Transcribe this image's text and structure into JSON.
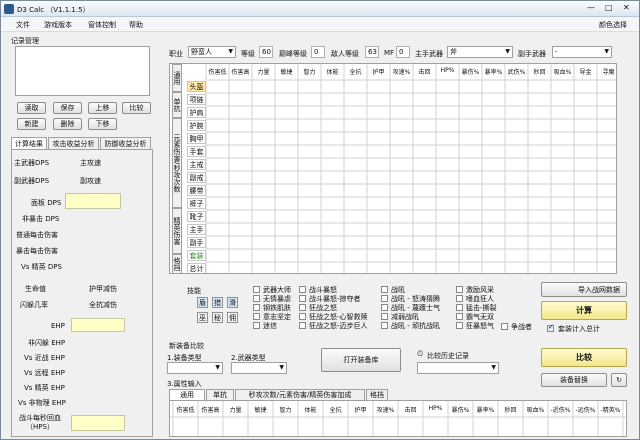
{
  "window": {
    "title": "D3 Calc （V1.1.1.5）",
    "controls": [
      "—",
      "□",
      "✕"
    ]
  },
  "menu": {
    "items": [
      "文件",
      "游戏版本",
      "窗体控制",
      "帮助"
    ],
    "right": "颜色选择"
  },
  "records": {
    "title": "记录管理",
    "buttons": [
      "读取",
      "保存",
      "上移",
      "比较",
      "新建",
      "删除",
      "下移"
    ]
  },
  "left_tabs": [
    "计算结果",
    "攻击收益分析",
    "防御收益分析"
  ],
  "results": {
    "labels1": [
      "主武器DPS",
      "主攻速",
      "副武器DPS",
      "副攻速"
    ],
    "panel_dps": "面板 DPS",
    "labels2": [
      "非暴击 DPS",
      "普通每击伤害",
      "暴击每击伤害",
      "Vs 精英 DPS"
    ],
    "labels3": [
      "生命值",
      "护甲减伤",
      "闪躲几率",
      "全抗减伤"
    ],
    "ehp_labels": [
      "EHP",
      "非闪躲 EHP",
      "Vs 近战 EHP",
      "Vs 远程 EHP",
      "Vs 精英 EHP",
      "Vs 非物理 EHP"
    ],
    "regen": "战斗每秒回血\n（HPS）"
  },
  "top_bar": {
    "career_label": "职业",
    "career_value": "野蛮人",
    "level_label": "等级",
    "level_value": "60",
    "paragon_label": "巅峰等级",
    "paragon_value": "0",
    "enemy_label": "敌人等级",
    "enemy_value": "63",
    "mf_label": "MF",
    "mf_value": "0",
    "main_weapon_label": "主手武器",
    "main_weapon_value": "斧",
    "off_label": "副手武器",
    "off_value": "-"
  },
  "grid": {
    "columns": [
      "伤害低",
      "伤害高",
      "力量",
      "敏捷",
      "智力",
      "体能",
      "全抗",
      "护甲",
      "攻速%",
      "击回",
      "HP%",
      "暴伤%",
      "暴率%",
      "武伤%",
      "秒回",
      "吸血%",
      "导金",
      "寻魔"
    ],
    "vtabs": [
      "通用",
      "单抗",
      "元素伤害/秒攻次数",
      "精英伤害",
      "格挡"
    ],
    "rows": [
      "头盔",
      "项链",
      "护肩",
      "护腕",
      "胸甲",
      "手套",
      "主戒",
      "副戒",
      "腰带",
      "裤子",
      "靴子",
      "主手",
      "副手",
      "套装",
      "总计"
    ]
  },
  "skills": {
    "label": "技能",
    "icons_row1": [
      "盾",
      "猎",
      "滑"
    ],
    "icons_row2": [
      "巫",
      "秘",
      "佣"
    ],
    "col1": [
      "武器大师",
      "无情暴虐",
      "钢铁肌肤",
      "意志坚定",
      "迷信"
    ],
    "col2": [
      "战斗暴怒",
      "战斗暴怒-掠夺者",
      "狂战之怒",
      "狂战之怒-心智救赎",
      "狂战之怒-迈步巨人"
    ],
    "col3": [
      "战吼",
      "战吼 - 怒涛猜腾",
      "战吼 - 蔑踱士气",
      "减弱战吼",
      "战吼 - 顽抗战吼"
    ],
    "col4": [
      "激励风采",
      "嗜血狂人",
      "猛击-撕裂",
      "霸气无双",
      "狂暴怒气"
    ],
    "extra": "争战者"
  },
  "right_panel": {
    "import_label": "导入战网数据",
    "calc": "计算",
    "set_count": "套装计入总计",
    "compare": "比较",
    "replace": "装备替换"
  },
  "compare": {
    "title": "新装备比较",
    "equip_type_label": "1.装备类型",
    "weapon_type_label": "2.武器类型",
    "open_button": "打开装备库",
    "history_label": "比较历史记录",
    "attr_label": "3.属性输入",
    "tabs": [
      "通用",
      "单抗",
      "秒攻次数/元素伤害/精英伤害加成",
      "格挡"
    ],
    "columns": [
      "伤害低",
      "伤害高",
      "力量",
      "敏捷",
      "智力",
      "体能",
      "全抗",
      "护甲",
      "攻速%",
      "击回",
      "HP%",
      "暴伤%",
      "暴率%",
      "秒回",
      "吸血%",
      "-近伤%",
      "-远伤%",
      "-精英%"
    ]
  }
}
